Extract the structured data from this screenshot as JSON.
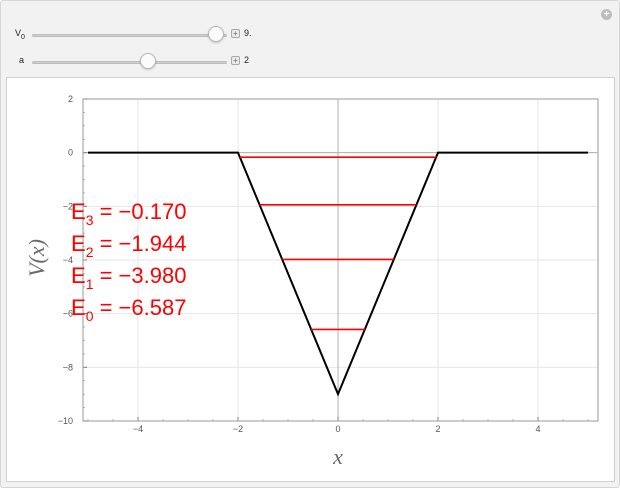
{
  "controls": [
    {
      "label": "V",
      "label_sub": "0",
      "value_text": "9.",
      "fraction": 0.945
    },
    {
      "label": "a",
      "label_sub": "",
      "value_text": "2",
      "fraction": 0.595
    }
  ],
  "chart_data": {
    "type": "line",
    "xlabel": "x",
    "ylabel": "V(x)",
    "xlim": [
      -5.1,
      5.2
    ],
    "ylim": [
      -10,
      2
    ],
    "x_ticks": [
      -4,
      -2,
      0,
      2,
      4
    ],
    "y_ticks": [
      2,
      0,
      -2,
      -4,
      -6,
      -8,
      -10
    ],
    "grid": true,
    "potential": {
      "color": "#000000",
      "x": [
        -5,
        -2,
        0,
        2,
        5
      ],
      "y": [
        0,
        0,
        -9,
        0,
        0
      ]
    },
    "levels": [
      {
        "name": "E",
        "sub": "3",
        "text": " = −0.170",
        "energy": -0.17
      },
      {
        "name": "E",
        "sub": "2",
        "text": " = −1.944",
        "energy": -1.944
      },
      {
        "name": "E",
        "sub": "1",
        "text": " = −3.980",
        "energy": -3.98
      },
      {
        "name": "E",
        "sub": "0",
        "text": " = −6.587",
        "energy": -6.587
      }
    ],
    "level_color": "#ff0000"
  }
}
